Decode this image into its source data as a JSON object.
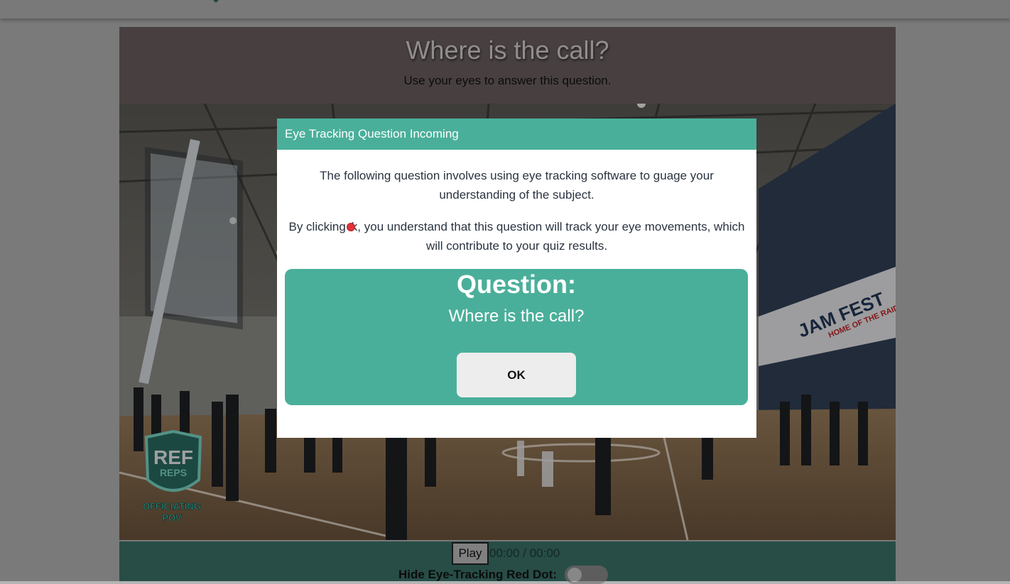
{
  "header": {
    "title": "Where is the call?",
    "subtitle": "Use your eyes to answer this question."
  },
  "video": {
    "logo_text_main": "REF",
    "logo_text_sub": "REPS",
    "logo_caption_1": "OFFICIATING",
    "logo_caption_2": "POV",
    "scene_banner": "JAM FEST",
    "scene_sign": "HOME OF THE RAIDERS"
  },
  "controls": {
    "play_label": "Play",
    "time_display": "00:00 / 00:00",
    "hide_dot_label": "Hide Eye-Tracking Red Dot:",
    "hide_dot_toggle_on": false
  },
  "modal": {
    "header_title": "Eye Tracking Question Incoming",
    "paragraph_1": "The following question involves using eye tracking software to guage your understanding of the subject.",
    "paragraph_2_before": "By clicking",
    "paragraph_2_after": "k, you understand that this question will track your eye movements, which will contribute to your quiz results.",
    "question_heading": "Question:",
    "question_text": "Where is the call?",
    "ok_label": "OK"
  },
  "colors": {
    "accent_teal": "#4aaf9a",
    "controls_bar": "#3a7268",
    "header_bar": "#6a5f5f",
    "eye_dot_red": "#e0343b"
  },
  "icons": {
    "eye_tracking_dot": "red-dot-icon",
    "brand_logo": "ref-reps-shield-logo"
  }
}
